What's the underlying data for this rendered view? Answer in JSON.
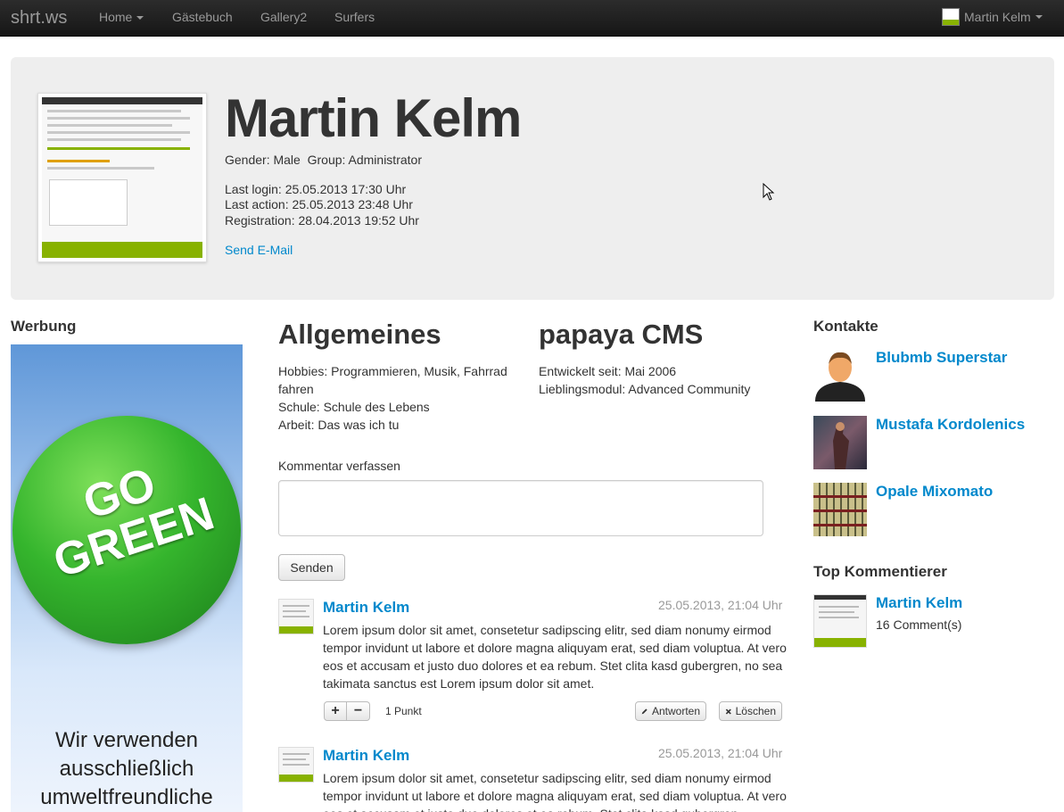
{
  "navbar": {
    "brand": "shrt.ws",
    "items": [
      {
        "label": "Home"
      },
      {
        "label": "Gästebuch"
      },
      {
        "label": "Gallery2"
      },
      {
        "label": "Surfers"
      }
    ],
    "user": "Martin Kelm"
  },
  "profile": {
    "name": "Martin Kelm",
    "gender_group": "Gender: Male  Group: Administrator",
    "last_login": "Last login: 25.05.2013 17:30 Uhr",
    "last_action": "Last action: 25.05.2013 23:48 Uhr",
    "registration": "Registration: 28.04.2013 19:52 Uhr",
    "send_email": "Send E-Mail"
  },
  "werbung": {
    "title": "Werbung",
    "ad_line1": "GO",
    "ad_line2": "GREEN",
    "ad_text1": "Wir verwenden",
    "ad_text2": "ausschließlich",
    "ad_text3": "umweltfreundliche"
  },
  "allgemeines": {
    "title": "Allgemeines",
    "hobbies": "Hobbies: Programmieren, Musik, Fahrrad fahren",
    "schule": "Schule: Schule des Lebens",
    "arbeit": "Arbeit: Das was ich tu"
  },
  "papaya": {
    "title": "papaya CMS",
    "entwickelt": "Entwickelt seit: Mai 2006",
    "modul": "Lieblingsmodul: Advanced Community"
  },
  "comment_form": {
    "label": "Kommentar verfassen",
    "value": "",
    "submit": "Senden"
  },
  "comments": [
    {
      "author": "Martin Kelm",
      "date": "25.05.2013, 21:04 Uhr",
      "body": "Lorem ipsum dolor sit amet, consetetur sadipscing elitr, sed diam nonumy eirmod tempor invidunt ut labore et dolore magna aliquyam erat, sed diam voluptua. At vero eos et accusam et justo duo dolores et ea rebum. Stet clita kasd gubergren, no sea takimata sanctus est Lorem ipsum dolor sit amet.",
      "plus": "+",
      "minus": "−",
      "points": "1 Punkt",
      "reply": "Antworten",
      "delete": "Löschen"
    },
    {
      "author": "Martin Kelm",
      "date": "25.05.2013, 21:04 Uhr",
      "body": "Lorem ipsum dolor sit amet, consetetur sadipscing elitr, sed diam nonumy eirmod tempor invidunt ut labore et dolore magna aliquyam erat, sed diam voluptua. At vero eos et accusam et justo duo dolores et ea rebum. Stet clita kasd gubergren,"
    }
  ],
  "kontakte": {
    "title": "Kontakte",
    "items": [
      {
        "name": "Blubmb Superstar"
      },
      {
        "name": "Mustafa Kordolenics"
      },
      {
        "name": "Opale Mixomato"
      }
    ]
  },
  "top": {
    "title": "Top Kommentierer",
    "name": "Martin Kelm",
    "count": "16 Comment(s)"
  },
  "colors": {
    "link": "#0088cc",
    "hero_bg": "#eeeeee",
    "navbar": "#1b1b1b",
    "accent_green": "#88b200"
  }
}
